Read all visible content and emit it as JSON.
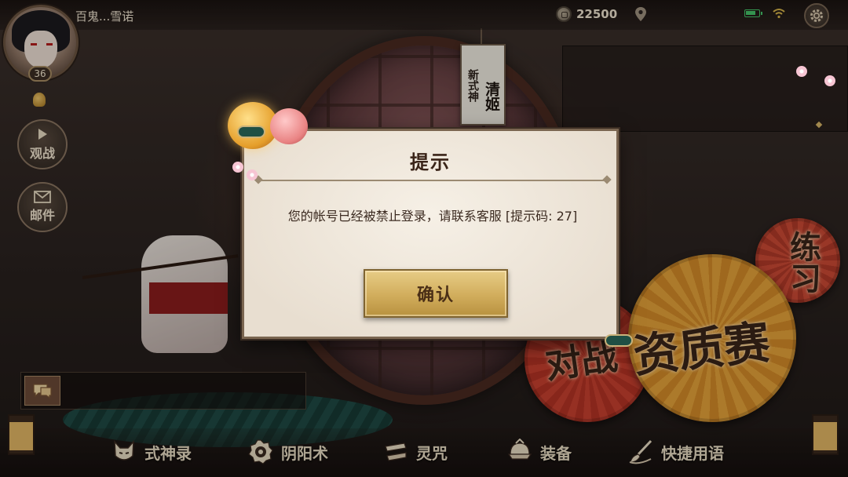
{
  "top_bar": {
    "player_name": "百鬼...雪诺",
    "currency_value": "22500",
    "currency_icon": "coin-icon",
    "location_icon": "location-pin-icon",
    "battery_icon": "battery-icon",
    "wifi_icon": "wifi-icon",
    "settings_icon": "gear-icon"
  },
  "avatar": {
    "level": "36"
  },
  "side_buttons": {
    "watch_label": "观战",
    "mail_label": "邮件"
  },
  "featured_tag": {
    "small_text": "新式神",
    "large_text": "清姬"
  },
  "modes": {
    "qualifier": "资质赛",
    "battle": "对战",
    "practice": "练习"
  },
  "dialog": {
    "title": "提示",
    "message": "您的帐号已经被禁止登录，请联系客服 [提示码: 27]",
    "confirm_label": "确认"
  },
  "bottom_nav": {
    "items": [
      {
        "label": "式神录",
        "icon": "fox-mask-icon"
      },
      {
        "label": "阴阳术",
        "icon": "yinyang-seal-icon"
      },
      {
        "label": "灵咒",
        "icon": "talisman-icon"
      },
      {
        "label": "装备",
        "icon": "helmet-icon"
      },
      {
        "label": "快捷用语",
        "icon": "brush-icon"
      }
    ]
  },
  "colors": {
    "accent_gold": "#d1ad5c",
    "dialog_bg": "#efe6d8",
    "battery_green": "#46c56a"
  }
}
